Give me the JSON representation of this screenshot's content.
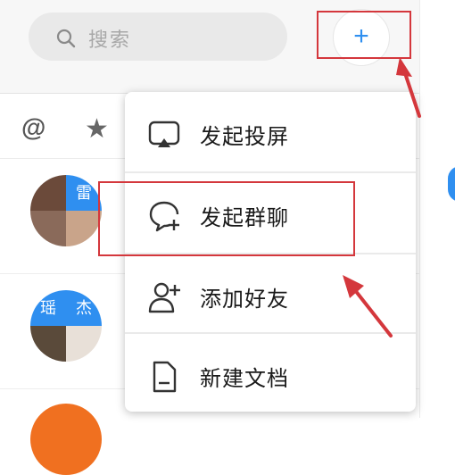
{
  "search": {
    "placeholder": "搜索"
  },
  "header": {
    "add_symbol": "+"
  },
  "filters": {
    "mentions_symbol": "@",
    "starred_symbol": "★"
  },
  "dropdown_menu": {
    "items": [
      {
        "label": "发起投屏",
        "icon": "screen-cast-icon"
      },
      {
        "label": "发起群聊",
        "icon": "group-chat-icon"
      },
      {
        "label": "添加好友",
        "icon": "add-friend-icon"
      },
      {
        "label": "新建文档",
        "icon": "document-icon"
      }
    ]
  },
  "conversations": [
    {
      "avatar_text": [
        "雷"
      ]
    },
    {
      "avatar_text": [
        "瑶",
        "杰"
      ]
    }
  ],
  "colors": {
    "accent": "#2f8ff0",
    "annotation": "#d4373c"
  }
}
